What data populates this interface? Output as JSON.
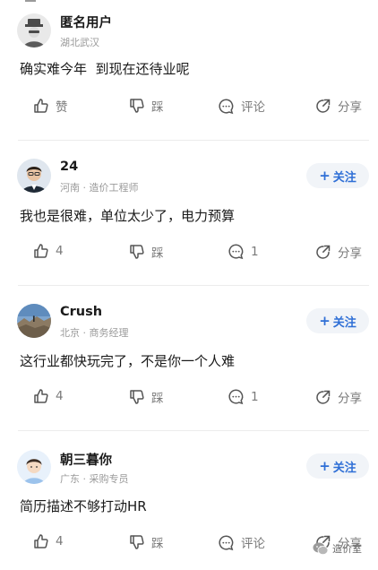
{
  "posts": [
    {
      "name": "匿名用户",
      "meta": "湖北武汉",
      "follow": "",
      "content": "确实难今年  到现在还待业呢",
      "actions": {
        "like": "赞",
        "dislike": "踩",
        "comment": "评论",
        "share": "分享"
      }
    },
    {
      "name": "24",
      "meta": "河南 · 造价工程师",
      "follow": "关注",
      "content": "我也是很难，单位太少了，电力预算",
      "actions": {
        "like": "4",
        "dislike": "踩",
        "comment": "1",
        "share": "分享"
      }
    },
    {
      "name": "Crush",
      "meta": "北京 · 商务经理",
      "follow": "关注",
      "content": "这行业都快玩完了，不是你一个人难",
      "actions": {
        "like": "4",
        "dislike": "踩",
        "comment": "1",
        "share": "分享"
      }
    },
    {
      "name": "朝三暮你",
      "meta": "广东 · 采购专员",
      "follow": "关注",
      "content": "简历描述不够打动HR",
      "actions": {
        "like": "4",
        "dislike": "踩",
        "comment": "评论",
        "share": "分享"
      }
    }
  ],
  "watermark": "造价室",
  "colors": {
    "accent": "#2f6fd6",
    "follow_bg": "#f1f4f8",
    "muted": "#9a9a9a"
  }
}
